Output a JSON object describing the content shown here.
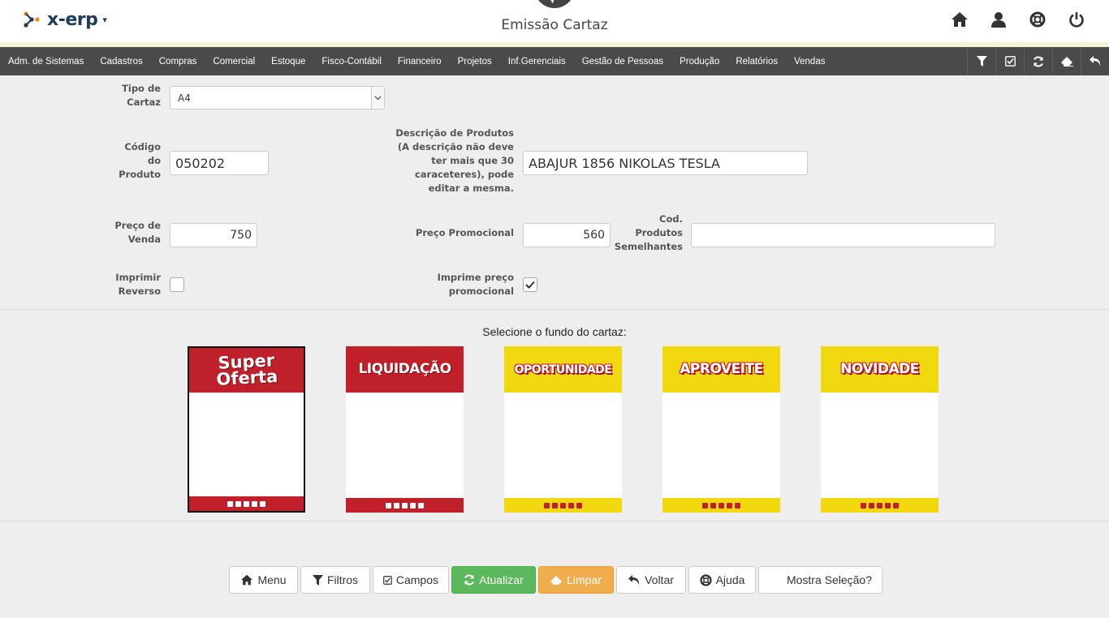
{
  "header": {
    "logo_text": "x-erp",
    "title": "Emissão Cartaz",
    "icons": [
      "home-icon",
      "user-icon",
      "help-lifebuoy-icon",
      "power-icon"
    ]
  },
  "menu": {
    "items": [
      "Adm. de Sistemas",
      "Cadastros",
      "Compras",
      "Comercial",
      "Estoque",
      "Fisco-Contábil",
      "Financeiro",
      "Projetos",
      "Inf.Gerenciais",
      "Gestão de Pessoas",
      "Produção",
      "Relatórios",
      "Vendas"
    ],
    "tools": [
      "filter-icon",
      "checkbox-icon",
      "refresh-icon",
      "eraser-icon",
      "undo-icon"
    ]
  },
  "form": {
    "tipo_cartaz": {
      "label_1": "Tipo de",
      "label_2": "Cartaz",
      "value": "A4"
    },
    "codigo_produto": {
      "label_1": "Código",
      "label_2": "do",
      "label_3": "Produto",
      "value": "050202"
    },
    "descricao": {
      "label_1": "Descrição de Produtos",
      "label_2": "(A descrição não deve",
      "label_3": "ter mais que 30",
      "label_4": "caraceteres), pode",
      "label_5": "editar a mesma.",
      "value": "ABAJUR 1856 NIKOLAS TESLA"
    },
    "preco_venda": {
      "label_1": "Preço de",
      "label_2": "Venda",
      "value": "750"
    },
    "preco_promocional": {
      "label": "Preço Promocional",
      "value": "560"
    },
    "cod_semelhantes": {
      "label_1": "Cod.",
      "label_2": "Produtos",
      "label_3": "Semelhantes",
      "value": ""
    },
    "imprimir_reverso": {
      "label_1": "Imprimir",
      "label_2": "Reverso",
      "checked": false
    },
    "imprime_preco_promo": {
      "label_1": "Imprime preço",
      "label_2": "promocional",
      "checked": true
    }
  },
  "background_select": {
    "prompt": "Selecione o fundo do cartaz:",
    "posters": [
      {
        "line_1": "Super",
        "line_2": "Oferta",
        "theme": "red",
        "selected": true
      },
      {
        "line_1": "LIQUIDAÇÃO",
        "theme": "red",
        "selected": false
      },
      {
        "line_1": "OPORTUNIDADE",
        "theme": "yellow",
        "selected": false
      },
      {
        "line_1": "APROVEITE",
        "theme": "yellow",
        "selected": false
      },
      {
        "line_1": "NOVIDADE",
        "theme": "yellow",
        "selected": false
      }
    ],
    "colors": {
      "red": "#c0202a",
      "yellow": "#f2d80f"
    }
  },
  "buttons": {
    "menu": "Menu",
    "filtros": "Filtros",
    "campos": "Campos",
    "atualizar": "Atualizar",
    "limpar": "Limpar",
    "voltar": "Voltar",
    "ajuda": "Ajuda",
    "mostra_selecao": "Mostra Seleção?"
  }
}
